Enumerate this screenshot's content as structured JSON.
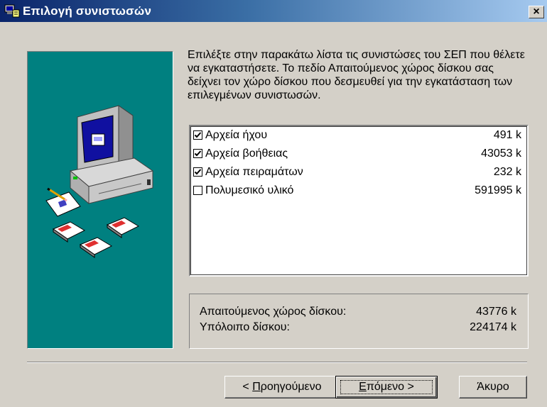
{
  "window": {
    "title": "Επιλογή συνιστωσών",
    "close_symbol": "×",
    "icon": "setup-app-icon"
  },
  "illustration": {
    "description_icons": [
      "computer-icon",
      "floppy-disk-icon",
      "document-icon"
    ],
    "background_color": "#008080"
  },
  "instructions": "Επιλέξτε στην παρακάτω λίστα τις συνιστώσες του ΣΕΠ που θέλετε να εγκαταστήσετε. Το πεδίο Απαιτούμενος χώρος δίσκου σας δείχνει τον χώρο δίσκου που δεσμευθεί για την εγκατάσταση των επιλεγμένων συνιστωσών.",
  "components": [
    {
      "name": "Αρχεία ήχου",
      "size": "491 k",
      "checked": true
    },
    {
      "name": "Αρχεία βοήθειας",
      "size": "43053 k",
      "checked": true
    },
    {
      "name": "Αρχεία πειραμάτων",
      "size": "232 k",
      "checked": true
    },
    {
      "name": "Πολυμεσικό υλικό",
      "size": "591995 k",
      "checked": false
    }
  ],
  "disk": {
    "required_label": "Απαιτούμενος χώρος δίσκου:",
    "required_value": "43776 k",
    "remaining_label": "Υπόλοιπο δίσκου:",
    "remaining_value": "224174 k"
  },
  "buttons": {
    "back": {
      "prefix": "< ",
      "mnemonic": "Π",
      "rest": "ροηγούμενο"
    },
    "next": {
      "mnemonic": "Ε",
      "rest": "πόμενο",
      "suffix": " >"
    },
    "cancel": "Άκυρο"
  }
}
